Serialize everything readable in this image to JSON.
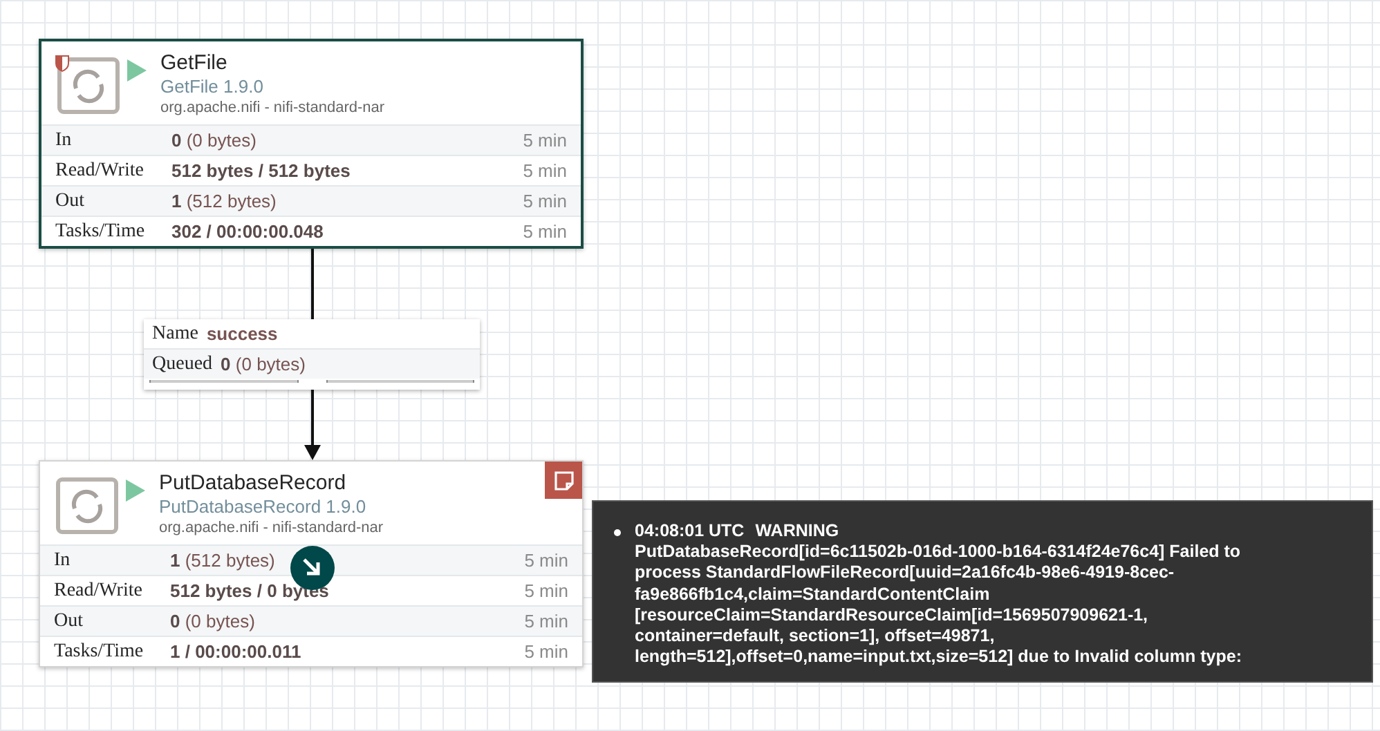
{
  "processors": [
    {
      "name": "GetFile",
      "type": "GetFile 1.9.0",
      "bundle": "org.apache.nifi - nifi-standard-nar",
      "restricted": true,
      "bulletin": false,
      "selected": true,
      "running": true,
      "stats": [
        {
          "label": "In",
          "value": "**0** (0 bytes)",
          "time": "5 min"
        },
        {
          "label": "Read/Write",
          "value": "**512 bytes / 512 bytes**",
          "time": "5 min"
        },
        {
          "label": "Out",
          "value": "**1** (512 bytes)",
          "time": "5 min"
        },
        {
          "label": "Tasks/Time",
          "value": "**302 / 00:00:00.048**",
          "time": "5 min"
        }
      ]
    },
    {
      "name": "PutDatabaseRecord",
      "type": "PutDatabaseRecord 1.9.0",
      "bundle": "org.apache.nifi - nifi-standard-nar",
      "restricted": false,
      "bulletin": true,
      "selected": false,
      "running": true,
      "stats": [
        {
          "label": "In",
          "value": "**1** (512 bytes)",
          "time": "5 min"
        },
        {
          "label": "Read/Write",
          "value": "**512 bytes / 0 bytes**",
          "time": "5 min"
        },
        {
          "label": "Out",
          "value": "**0** (0 bytes)",
          "time": "5 min"
        },
        {
          "label": "Tasks/Time",
          "value": "**1 / 00:00:00.011**",
          "time": "5 min"
        }
      ]
    }
  ],
  "connection": {
    "name_label": "Name",
    "name": "success",
    "queued_label": "Queued",
    "queued": "**0** (0 bytes)",
    "backpressure": [
      {
        "level": 0
      },
      {
        "level": 0
      }
    ]
  },
  "tooltip": {
    "bulletins": [
      {
        "time": "04:08:01 UTC",
        "level": "WARNING",
        "message": "PutDatabaseRecord[id=6c11502b-016d-1000-b164-6314f24e76c4] Failed to process StandardFlowFileRecord[uuid=2a16fc4b-98e6-4919-8cec-fa9e866fb1c4,claim=StandardContentClaim [resourceClaim=StandardResourceClaim[id=1569507909621-1, container=default, section=1], offset=49871, length=512],offset=0,name=input.txt,size=512] due to Invalid column type:"
      }
    ]
  }
}
